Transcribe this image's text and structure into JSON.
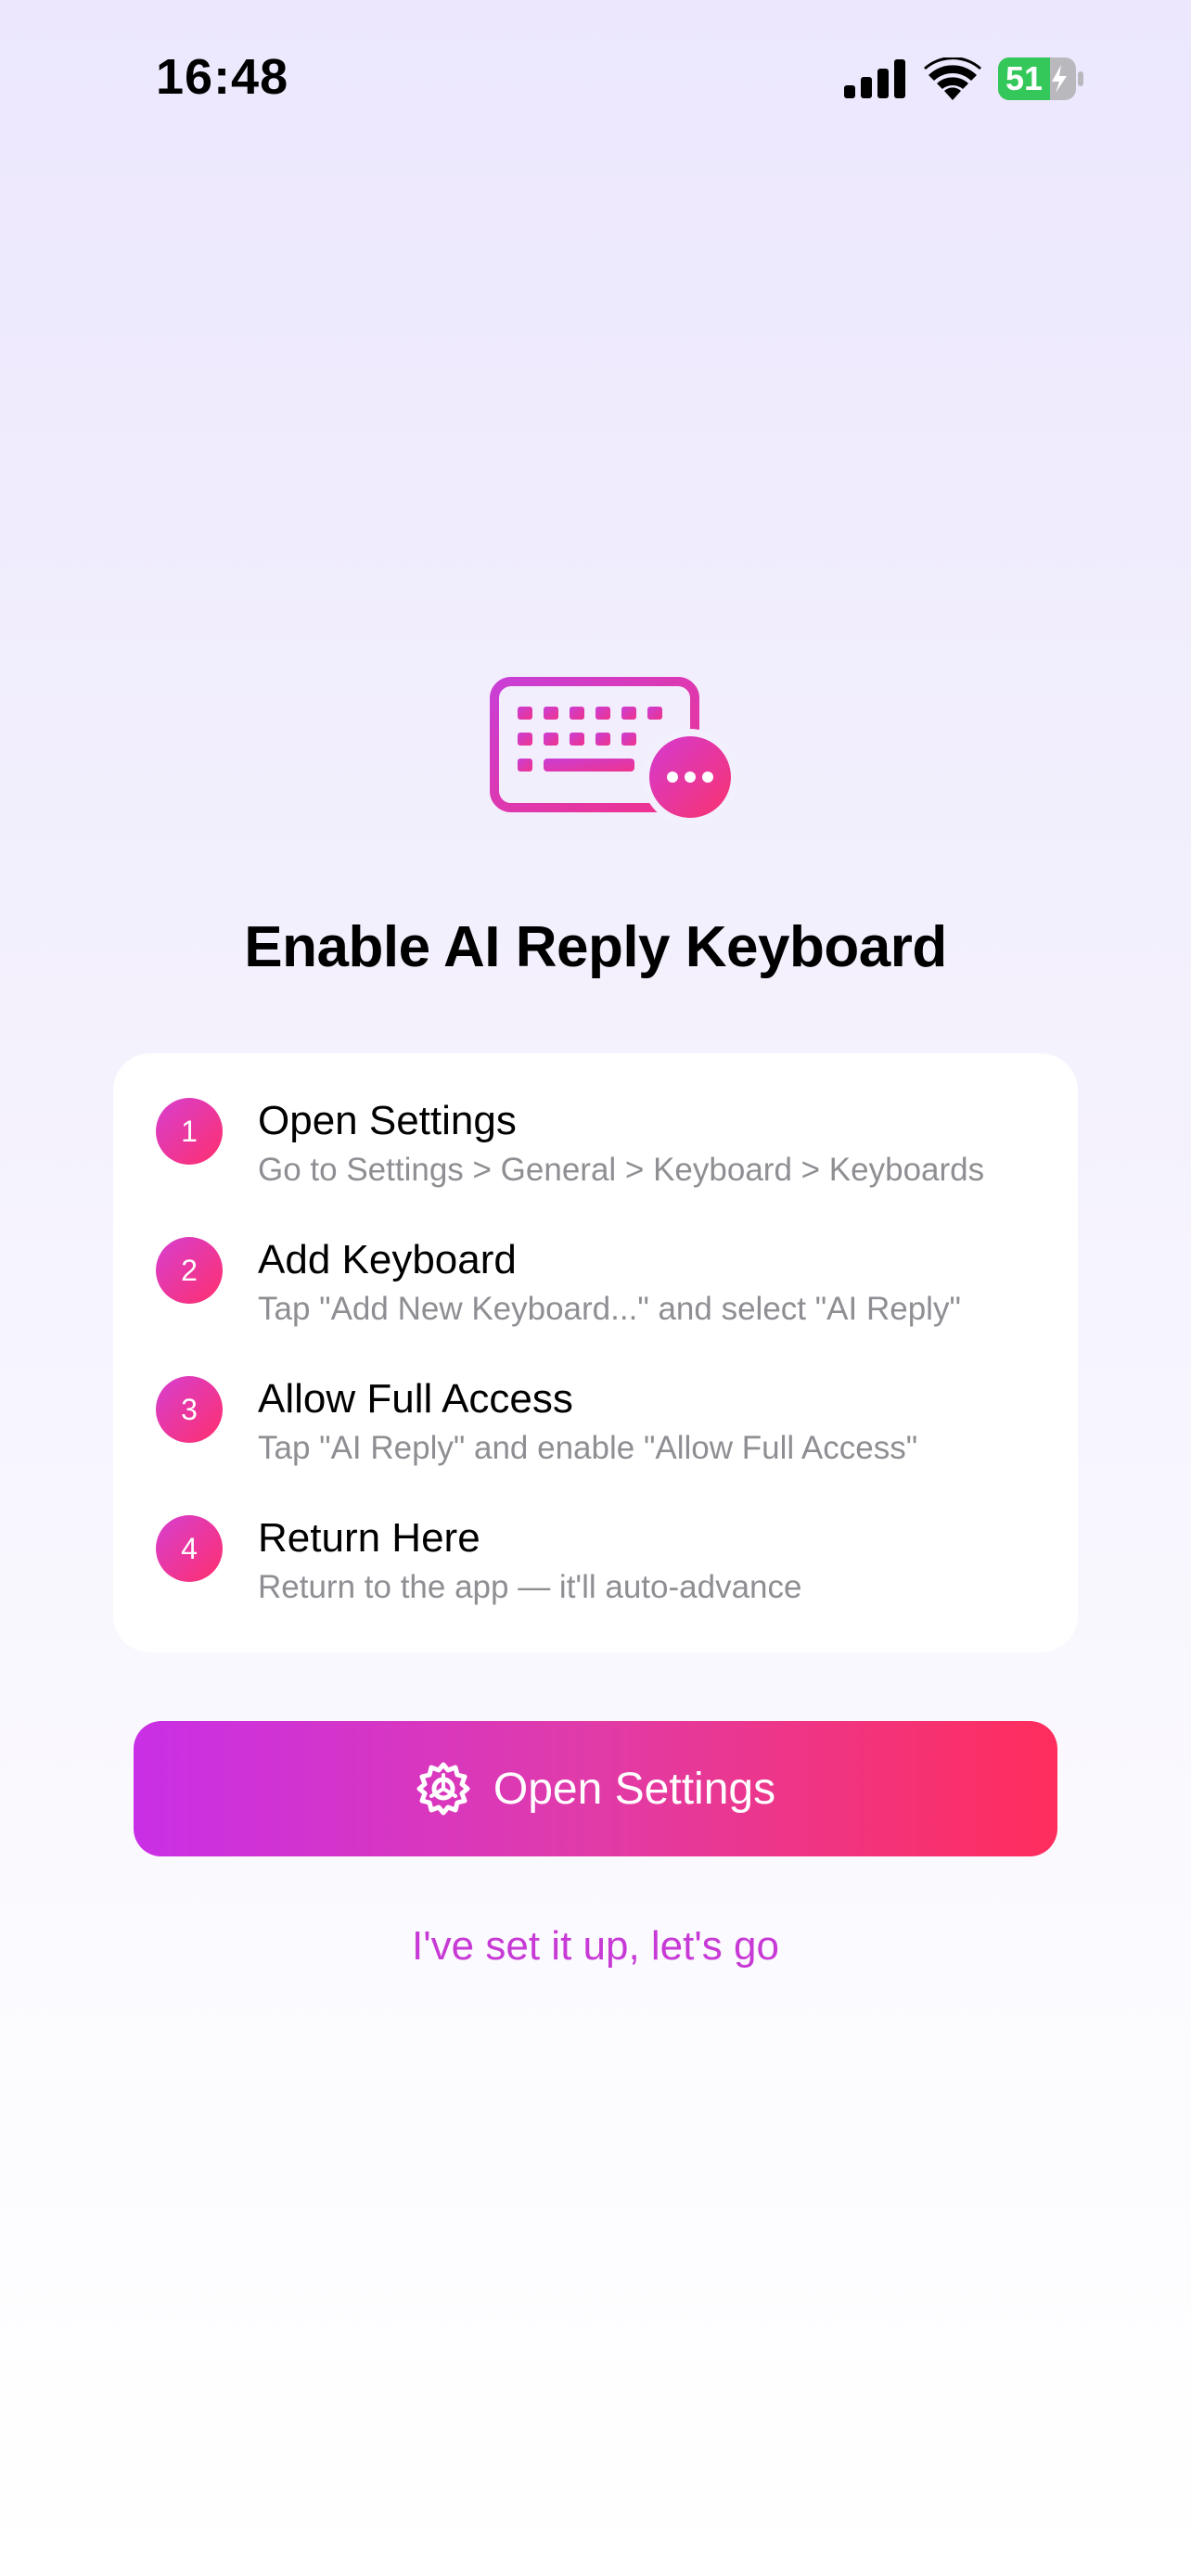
{
  "status_bar": {
    "time": "16:48",
    "battery": "51",
    "icons": [
      "signal-icon",
      "wifi-icon",
      "battery-charging-icon"
    ]
  },
  "hero": {
    "icon": "keyboard-with-chat-bubble-icon",
    "title": "Enable AI Reply Keyboard"
  },
  "steps": [
    {
      "number": "1",
      "title": "Open Settings",
      "desc": "Go to Settings > General > Keyboard > Keyboards"
    },
    {
      "number": "2",
      "title": "Add Keyboard",
      "desc": "Tap \"Add New Keyboard...\" and select \"AI Reply\""
    },
    {
      "number": "3",
      "title": "Allow Full Access",
      "desc": "Tap \"AI Reply\" and enable \"Allow Full Access\""
    },
    {
      "number": "4",
      "title": "Return Here",
      "desc": "Return to the app — it'll auto-advance"
    }
  ],
  "primary_button": {
    "label": "Open Settings",
    "icon": "gear-icon"
  },
  "secondary_link": {
    "label": "I've set it up, let's go"
  },
  "colors": {
    "accent_start": "#c92fe6",
    "accent_end": "#ff2d5c",
    "link": "#c73ad5",
    "battery_green": "#34c759"
  }
}
